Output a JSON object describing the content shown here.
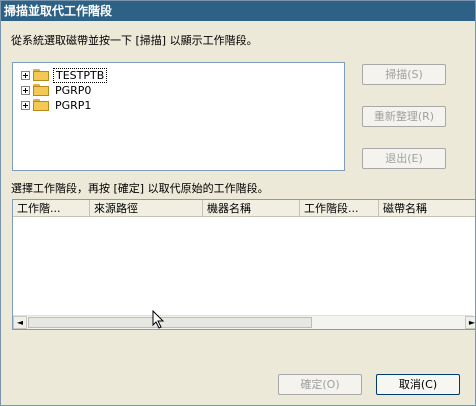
{
  "dialog": {
    "title": "掃描並取代工作階段",
    "instruction": "從系統選取磁帶並按一下 [掃描] 以顯示工作階段。",
    "replace_instruction": "選擇工作階段，再按 [確定] 以取代原始的工作階段。"
  },
  "tree": {
    "items": [
      {
        "label": "TESTPTB",
        "selected": true
      },
      {
        "label": "PGRP0",
        "selected": false
      },
      {
        "label": "PGRP1",
        "selected": false
      }
    ]
  },
  "buttons": {
    "scan": "掃描(S)",
    "refresh": "重新整理(R)",
    "eject": "退出(E)",
    "ok": "確定(O)",
    "cancel": "取消(C)"
  },
  "table": {
    "columns": [
      "工作階...",
      "來源路徑",
      "機器名稱",
      "工作階段...",
      "磁帶名稱"
    ]
  },
  "colors": {
    "title_bar": "#2d6186",
    "dialog_bg": "#ece9d8",
    "folder": "#f3c954"
  }
}
